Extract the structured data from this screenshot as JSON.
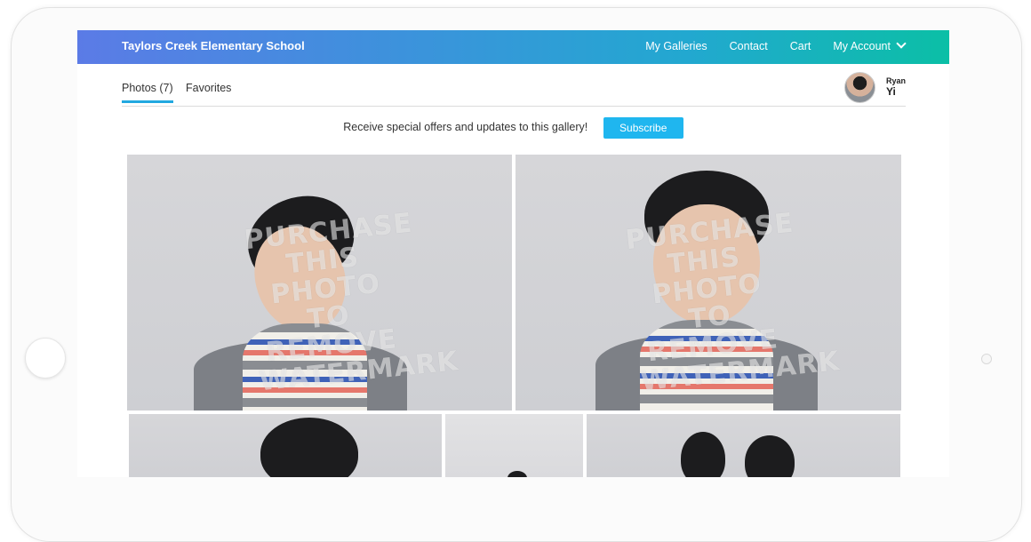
{
  "header": {
    "school_name": "Taylors Creek Elementary School",
    "nav": [
      "My Galleries",
      "Contact",
      "Cart",
      "My Account"
    ]
  },
  "tabs": [
    {
      "label": "Photos (7)",
      "active": true
    },
    {
      "label": "Favorites",
      "active": false
    }
  ],
  "user": {
    "first_name": "Ryan",
    "last_name": "Yi"
  },
  "promo": {
    "text": "Receive special offers and updates to this gallery!",
    "button": "Subscribe"
  },
  "watermark": {
    "line1": "PURCHASE",
    "line2": "THIS PHOTO",
    "line3": "TO REMOVE",
    "line4": "WATERMARK"
  },
  "colors": {
    "header_start": "#5b7be6",
    "header_end": "#0bbfa6",
    "accent": "#1fb6ef"
  },
  "icons": {
    "account_dropdown": "chevron-down-icon"
  }
}
